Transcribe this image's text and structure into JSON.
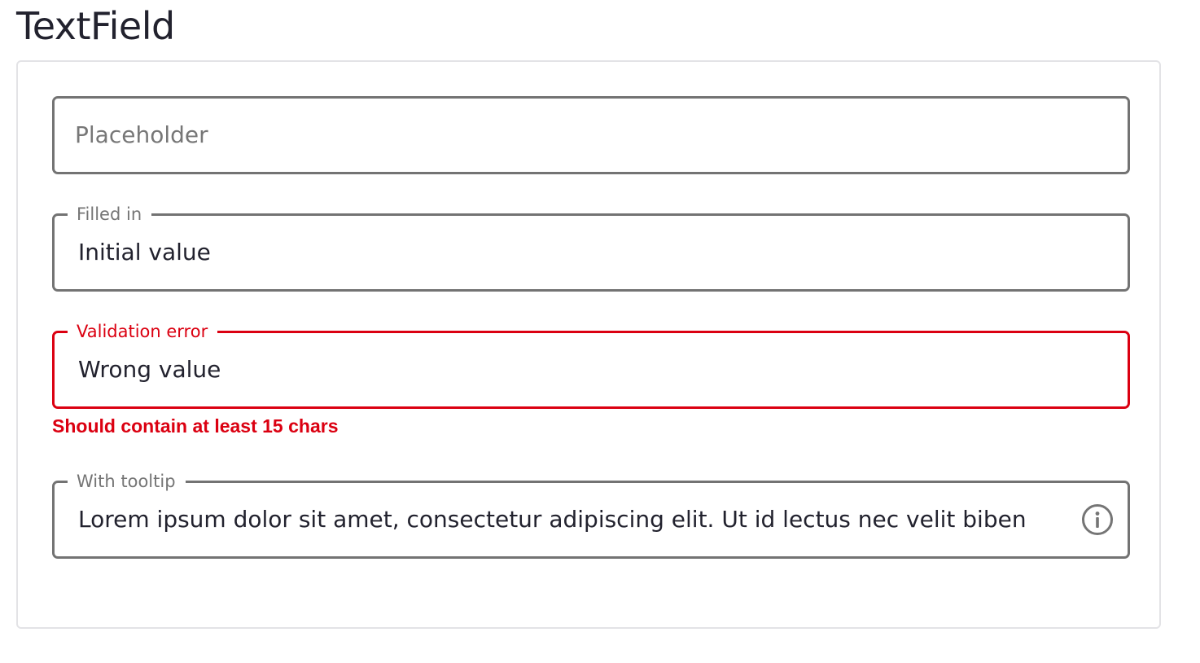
{
  "page": {
    "title": "TextField"
  },
  "fields": {
    "placeholder_field": {
      "placeholder": "Placeholder"
    },
    "filled_field": {
      "label": "Filled in",
      "value": "Initial value"
    },
    "error_field": {
      "label": "Validation error",
      "value": "Wrong value",
      "error_message": "Should contain at least 15 chars"
    },
    "tooltip_field": {
      "label": "With tooltip",
      "value": "Lorem ipsum dolor sit amet, consectetur adipiscing elit. Ut id lectus nec velit biben",
      "icon": "info-icon"
    }
  },
  "colors": {
    "border": "#737373",
    "error": "#db0011",
    "text": "#22222e",
    "label": "#757575"
  }
}
